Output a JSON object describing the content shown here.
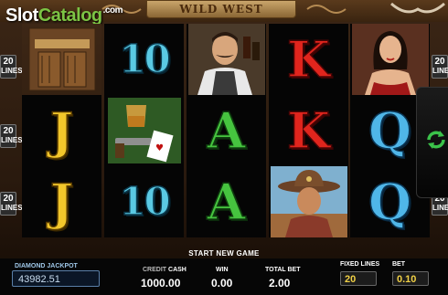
{
  "watermark": {
    "brand_part1": "Slot",
    "brand_part2": "Catalog",
    "brand_suffix": ".com"
  },
  "header": {
    "title": "WILD WEST"
  },
  "paylines": {
    "count": "20",
    "label": "LINES"
  },
  "reels": [
    [
      "saloon-doors",
      "J",
      "J"
    ],
    [
      "10",
      "whiskey-and-revolver",
      "10"
    ],
    [
      "bartender",
      "A",
      "A"
    ],
    [
      "K",
      "K",
      "cowboy"
    ],
    [
      "showgirl",
      "Q",
      "Q"
    ]
  ],
  "status": {
    "message": "START NEW GAME"
  },
  "jackpot": {
    "label": "DIAMOND JACKPOT",
    "value": "43982.51"
  },
  "credit": {
    "label_prefix": "CREDIT",
    "label": "CASH",
    "value": "1000.00"
  },
  "win": {
    "label": "WIN",
    "value": "0.00"
  },
  "total_bet": {
    "label": "TOTAL BET",
    "value": "2.00"
  },
  "fixed_lines": {
    "label": "FIXED LINES",
    "value": "20"
  },
  "bet": {
    "label": "BET",
    "value": "0.10"
  },
  "colors": {
    "accent_green": "#46c43f",
    "accent_red": "#e0251d",
    "accent_yellow": "#f3c72b",
    "accent_blue": "#4fb6e8",
    "value_gold": "#f0d046"
  }
}
